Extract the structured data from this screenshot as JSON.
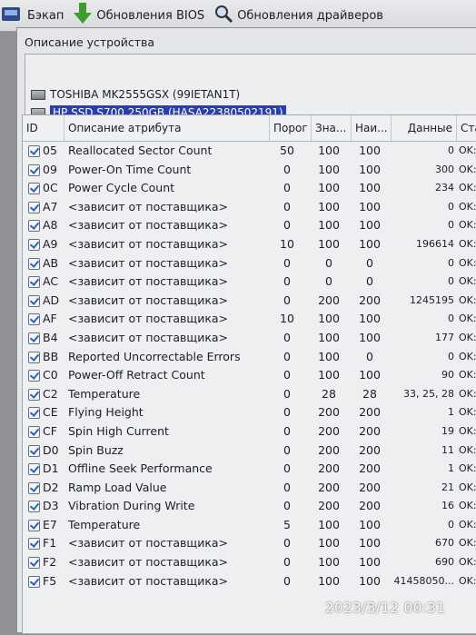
{
  "toolbar": {
    "backup_label": "Бэкап",
    "bios_label": "Обновления BIOS",
    "drivers_label": "Обновления драйверов"
  },
  "devices": {
    "label": "Описание устройства",
    "items": [
      {
        "text": "TOSHIBA MK2555GSX (99IETAN1T)"
      },
      {
        "text": "HP SSD S700 250GB (HASA22380502191)"
      }
    ]
  },
  "table": {
    "headers": {
      "id": "ID",
      "desc": "Описание атрибута",
      "threshold": "Порог",
      "value": "Зна...",
      "worst": "Наи...",
      "raw": "Данные",
      "status": "Ста"
    },
    "rows": [
      {
        "id": "05",
        "name": "Reallocated Sector Count",
        "thr": "50",
        "val": "100",
        "worst": "100",
        "raw": "0",
        "status": "OK:"
      },
      {
        "id": "09",
        "name": "Power-On Time Count",
        "thr": "0",
        "val": "100",
        "worst": "100",
        "raw": "300",
        "status": "OK:"
      },
      {
        "id": "0C",
        "name": "Power Cycle Count",
        "thr": "0",
        "val": "100",
        "worst": "100",
        "raw": "234",
        "status": "OK:"
      },
      {
        "id": "A7",
        "name": "<зависит от поставщика>",
        "thr": "0",
        "val": "100",
        "worst": "100",
        "raw": "0",
        "status": "OK:"
      },
      {
        "id": "A8",
        "name": "<зависит от поставщика>",
        "thr": "0",
        "val": "100",
        "worst": "100",
        "raw": "0",
        "status": "OK:"
      },
      {
        "id": "A9",
        "name": "<зависит от поставщика>",
        "thr": "10",
        "val": "100",
        "worst": "100",
        "raw": "196614",
        "status": "OK:"
      },
      {
        "id": "AB",
        "name": "<зависит от поставщика>",
        "thr": "0",
        "val": "0",
        "worst": "0",
        "raw": "0",
        "status": "OK:"
      },
      {
        "id": "AC",
        "name": "<зависит от поставщика>",
        "thr": "0",
        "val": "0",
        "worst": "0",
        "raw": "0",
        "status": "OK:"
      },
      {
        "id": "AD",
        "name": "<зависит от поставщика>",
        "thr": "0",
        "val": "200",
        "worst": "200",
        "raw": "1245195",
        "status": "OK:"
      },
      {
        "id": "AF",
        "name": "<зависит от поставщика>",
        "thr": "10",
        "val": "100",
        "worst": "100",
        "raw": "0",
        "status": "OK:"
      },
      {
        "id": "B4",
        "name": "<зависит от поставщика>",
        "thr": "0",
        "val": "100",
        "worst": "100",
        "raw": "177",
        "status": "OK:"
      },
      {
        "id": "BB",
        "name": "Reported Uncorrectable Errors",
        "thr": "0",
        "val": "100",
        "worst": "0",
        "raw": "0",
        "status": "OK:"
      },
      {
        "id": "C0",
        "name": "Power-Off Retract Count",
        "thr": "0",
        "val": "100",
        "worst": "100",
        "raw": "90",
        "status": "OK:"
      },
      {
        "id": "C2",
        "name": "Temperature",
        "thr": "0",
        "val": "28",
        "worst": "28",
        "raw": "33, 25, 28",
        "status": "OK:"
      },
      {
        "id": "CE",
        "name": "Flying Height",
        "thr": "0",
        "val": "200",
        "worst": "200",
        "raw": "1",
        "status": "OK:"
      },
      {
        "id": "CF",
        "name": "Spin High Current",
        "thr": "0",
        "val": "200",
        "worst": "200",
        "raw": "19",
        "status": "OK:"
      },
      {
        "id": "D0",
        "name": "Spin Buzz",
        "thr": "0",
        "val": "200",
        "worst": "200",
        "raw": "11",
        "status": "OK:"
      },
      {
        "id": "D1",
        "name": "Offline Seek Performance",
        "thr": "0",
        "val": "200",
        "worst": "200",
        "raw": "1",
        "status": "OK:"
      },
      {
        "id": "D2",
        "name": "Ramp Load Value",
        "thr": "0",
        "val": "200",
        "worst": "200",
        "raw": "21",
        "status": "OK:"
      },
      {
        "id": "D3",
        "name": "Vibration During Write",
        "thr": "0",
        "val": "200",
        "worst": "200",
        "raw": "16",
        "status": "OK:"
      },
      {
        "id": "E7",
        "name": "Temperature",
        "thr": "5",
        "val": "100",
        "worst": "100",
        "raw": "0",
        "status": "OK:"
      },
      {
        "id": "F1",
        "name": "<зависит от поставщика>",
        "thr": "0",
        "val": "100",
        "worst": "100",
        "raw": "670",
        "status": "OK:"
      },
      {
        "id": "F2",
        "name": "<зависит от поставщика>",
        "thr": "0",
        "val": "100",
        "worst": "100",
        "raw": "690",
        "status": "OK:"
      },
      {
        "id": "F5",
        "name": "<зависит от поставщика>",
        "thr": "0",
        "val": "100",
        "worst": "100",
        "raw": "41458050...",
        "status": "OK:"
      }
    ]
  },
  "timestamp": "2023/3/12 00:31"
}
